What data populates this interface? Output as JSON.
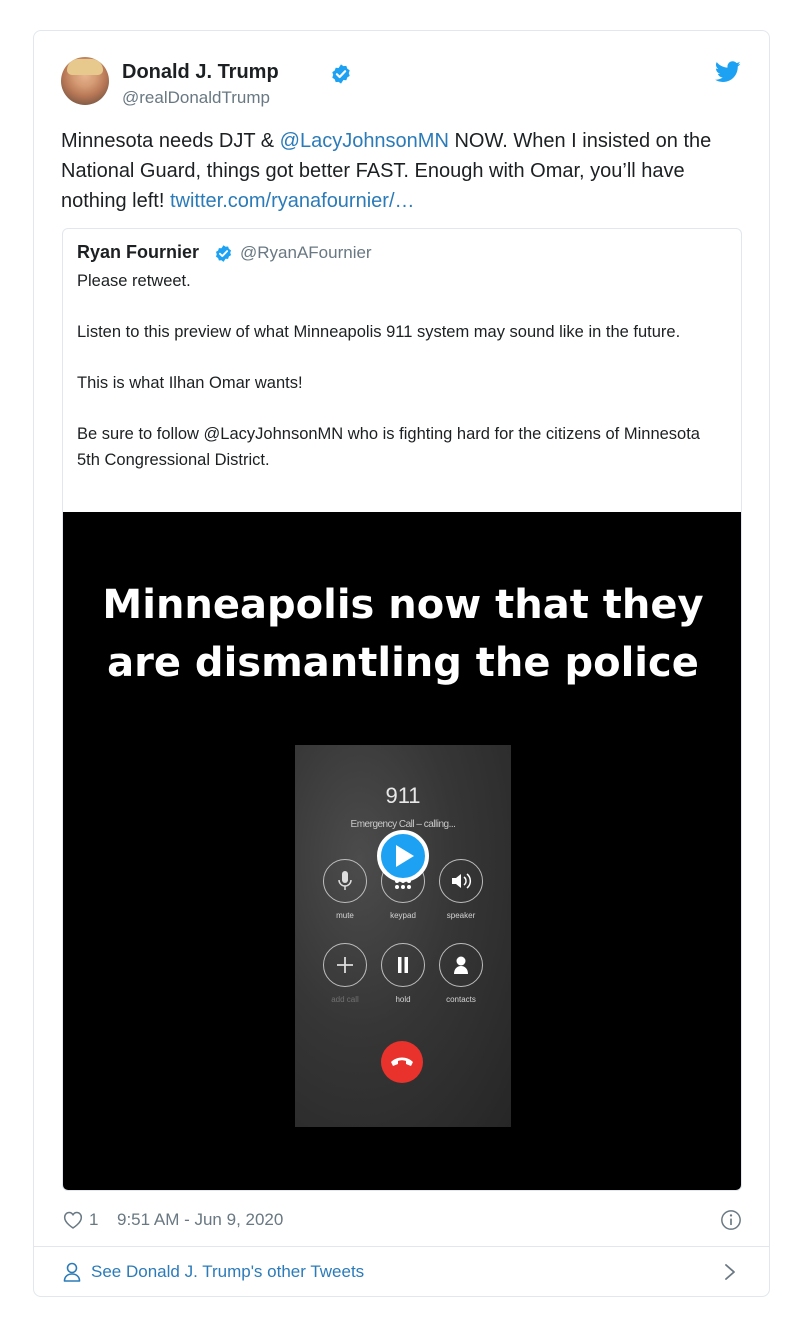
{
  "tweet": {
    "author_name": "Donald J. Trump",
    "handle": "@realDonaldTrump",
    "text_parts": {
      "p1": "Minnesota needs DJT & ",
      "mention": "@LacyJohnsonMN",
      "p2": " NOW. When I insisted on the National Guard, things got better FAST. Enough with Omar, you’ll have nothing left! ",
      "link": "twitter.com/ryanafournier/…"
    },
    "likes": "1",
    "timestamp": "9:51 AM - Jun 9, 2020"
  },
  "quoted_tweet": {
    "author_name": "Ryan Fournier",
    "handle": "@RyanAFournier",
    "paragraphs": [
      "Please retweet.",
      "Listen to this preview of what Minneapolis 911 system may sound like in the future.",
      "This is what Ilhan Omar wants!",
      "Be sure to follow @LacyJohnsonMN who is fighting hard for the citizens of Minnesota 5th Congressional District."
    ],
    "video": {
      "caption_line1": "Minneapolis now that they",
      "caption_line2": "are dismantling the police",
      "phone": {
        "number": "911",
        "status": "Emergency Call – calling...",
        "buttons": {
          "mute": "mute",
          "keypad": "keypad",
          "speaker": "speaker",
          "add_call": "add call",
          "hold": "hold",
          "contacts": "contacts"
        }
      }
    }
  },
  "footer": {
    "see_more": "See Donald J. Trump's other Tweets"
  },
  "colors": {
    "link": "#2b7bb9",
    "verified": "#1da1f2",
    "muted": "#697882",
    "end_call": "#e8322b"
  },
  "icons": [
    "verified-badge-icon",
    "twitter-bird-icon",
    "heart-icon",
    "info-icon",
    "person-icon",
    "chevron-right-icon",
    "play-icon",
    "microphone-icon",
    "keypad-icon",
    "speaker-icon",
    "plus-icon",
    "pause-icon",
    "contact-icon",
    "phone-hangup-icon"
  ]
}
